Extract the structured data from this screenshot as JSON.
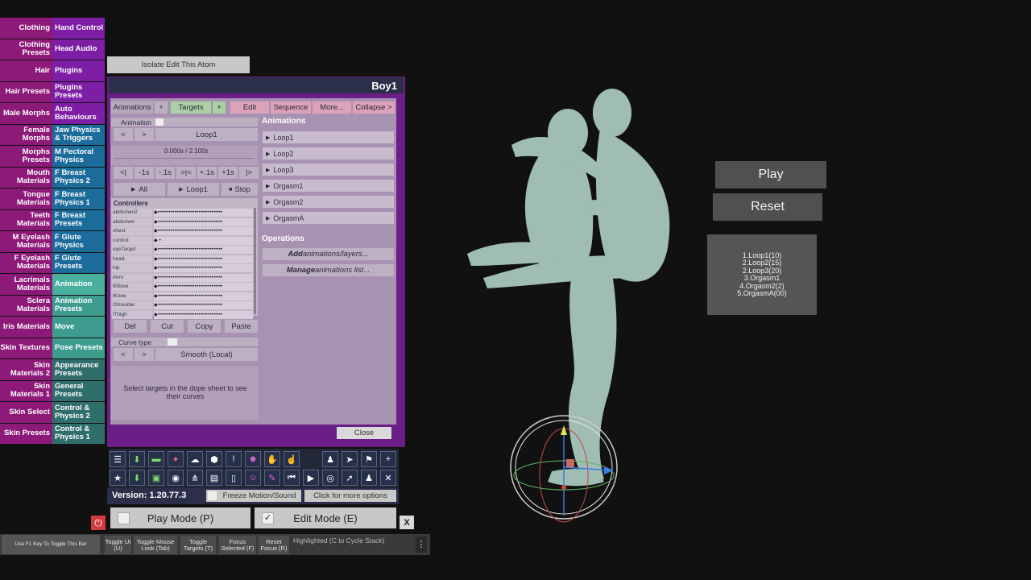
{
  "tabs_left": [
    {
      "label": "Clothing",
      "color": "#8d1a78"
    },
    {
      "label": "Clothing Presets",
      "color": "#8d1a78"
    },
    {
      "label": "Hair",
      "color": "#8d1a78"
    },
    {
      "label": "Hair Presets",
      "color": "#8d1a78"
    },
    {
      "label": "Male Morphs",
      "color": "#8d1a78"
    },
    {
      "label": "Female Morphs",
      "color": "#8d1a78"
    },
    {
      "label": "Morphs Presets",
      "color": "#8d1a78"
    },
    {
      "label": "Mouth Materials",
      "color": "#8d1a78"
    },
    {
      "label": "Tongue Materials",
      "color": "#8d1a78"
    },
    {
      "label": "Teeth Materials",
      "color": "#8d1a78"
    },
    {
      "label": "M Eyelash Materials",
      "color": "#8d1a78"
    },
    {
      "label": "F Eyelash Materials",
      "color": "#8d1a78"
    },
    {
      "label": "Lacrimals Materials",
      "color": "#8d1a78"
    },
    {
      "label": "Sclera Materials",
      "color": "#8d1a78"
    },
    {
      "label": "Iris Materials",
      "color": "#8d1a78"
    },
    {
      "label": "Skin Textures",
      "color": "#8d1a78"
    },
    {
      "label": "Skin Materials 2",
      "color": "#8d1a78"
    },
    {
      "label": "Skin Materials 1",
      "color": "#8d1a78"
    },
    {
      "label": "Skin Select",
      "color": "#8d1a78"
    },
    {
      "label": "Skin Presets",
      "color": "#8d1a78"
    }
  ],
  "tabs_right": [
    {
      "label": "Hand Control",
      "color": "#7d1ea5"
    },
    {
      "label": "Head Audio",
      "color": "#7d1ea5"
    },
    {
      "label": "Plugins",
      "color": "#7d1ea5"
    },
    {
      "label": "Plugins Presets",
      "color": "#7d1ea5"
    },
    {
      "label": "Auto Behaviours",
      "color": "#7d1ea5"
    },
    {
      "label": "Jaw Physics & Triggers",
      "color": "#1c6c9b"
    },
    {
      "label": "M Pectoral Physics",
      "color": "#1c6c9b"
    },
    {
      "label": "F Breast Physics 2",
      "color": "#1c6c9b"
    },
    {
      "label": "F Breast Physics 1",
      "color": "#1c6c9b"
    },
    {
      "label": "F Breast Presets",
      "color": "#1c6c9b"
    },
    {
      "label": "F Glute Physics",
      "color": "#1c6c9b"
    },
    {
      "label": "F Glute Presets",
      "color": "#1c6c9b"
    },
    {
      "label": "Animation",
      "color": "#4ab09e"
    },
    {
      "label": "Animation Presets",
      "color": "#3e9c8e"
    },
    {
      "label": "Move",
      "color": "#3e9c8e"
    },
    {
      "label": "Pose Presets",
      "color": "#3e9c8e"
    },
    {
      "label": "Appearance Presets",
      "color": "#2f6e6a"
    },
    {
      "label": "General Presets",
      "color": "#2f6e6a"
    },
    {
      "label": "Control & Physics 2",
      "color": "#2f6e6a"
    },
    {
      "label": "Control & Physics 1",
      "color": "#2f6e6a"
    }
  ],
  "isolate_button": "Isolate Edit This Atom",
  "panel": {
    "title": "Boy1",
    "tabs": {
      "animations": "Animations",
      "plus1": "+",
      "targets": "Targets",
      "plus2": "+",
      "edit": "Edit",
      "sequence": "Sequence",
      "more": "More...",
      "collapse": "Collapse >"
    },
    "animation_label": "Animation",
    "prev": "<",
    "next": ">",
    "current_animation": "Loop1",
    "time_readout": "0.000s / 2.100s",
    "transport": [
      "<|",
      "-1s",
      "-.1s",
      ">|<",
      "+.1s",
      "+1s",
      "|>"
    ],
    "play_all": "All",
    "play_loop": "Loop1",
    "stop": "Stop",
    "controllers_header": "Controllers",
    "controllers": [
      {
        "name": "abdomen2",
        "dots": "◆•••••••••••••••••••••••••••••••••••"
      },
      {
        "name": "abdomen",
        "dots": "◆•••••••••••••••••••••••••••••••••••"
      },
      {
        "name": "chest",
        "dots": "◆•••••••••••••••••••••••••••••••••••"
      },
      {
        "name": "control",
        "dots": "◆           •"
      },
      {
        "name": "eyeTarget",
        "dots": "◆•••••••••••••••••••••••••••••••••••"
      },
      {
        "name": "head",
        "dots": "◆•••••••••••••••••••••••••••••••••••"
      },
      {
        "name": "hip",
        "dots": "◆•••••••••••••••••••••••••••••••••••"
      },
      {
        "name": "lArm",
        "dots": "◆•••••••••••••••••••••••••••••••••••"
      },
      {
        "name": "lElbow",
        "dots": "◆•••••••••••••••••••••••••••••••••••"
      },
      {
        "name": "lKnee",
        "dots": "◆•••••••••••••••••••••••••••••••••••"
      },
      {
        "name": "lShoulder",
        "dots": "◆•••••••••••••••••••••••••••••••••••"
      },
      {
        "name": "lThigh",
        "dots": "◆•••••••••••••••••••••••••••••••••••"
      }
    ],
    "edit_buttons": [
      "Del",
      "Cut",
      "Copy",
      "Paste"
    ],
    "curve_type_label": "Curve type",
    "curve_value": "Smooth (Local)",
    "hint": "Select targets in the dope sheet to see their curves",
    "animations_header": "Animations",
    "animations": [
      "Loop1",
      "Loop2",
      "Loop3",
      "Orgasm1",
      "Orgasm2",
      "OrgasmA"
    ],
    "operations_header": "Operations",
    "op_add_bold": "Add",
    "op_add_rest": " animations/layers...",
    "op_manage_bold": "Manage",
    "op_manage_rest": " animations list...",
    "close": "Close"
  },
  "toolbar_icons_row1": [
    "menu-icon",
    "save-icon",
    "folder-icon",
    "scene-icon",
    "cloud-icon",
    "package-icon",
    "alert-icon",
    "person-add-icon",
    "hand-icon",
    "hand-point-icon",
    "person-icon",
    "send-icon",
    "flag-icon",
    "plus-icon"
  ],
  "toolbar_icons_row2": [
    "star-icon",
    "save-alt-icon",
    "folder-add-icon",
    "camera-icon",
    "nodes-icon",
    "box-icon",
    "document-icon",
    "person-edit-icon",
    "wrench-icon",
    "skip-back-icon",
    "play-icon",
    "target-icon",
    "cursor-icon",
    "people-icon",
    "tools-icon"
  ],
  "version": "Version: 1.20.77.3",
  "freeze": "Freeze Motion/Sound",
  "more_options": "Click for more options",
  "play_mode": "Play Mode (P)",
  "edit_mode": "Edit Mode (E)",
  "close_x": "X",
  "bottom_bar": {
    "hint": "Use F1 Key To Toggle This Bar",
    "toggle_ui": "Toggle UI (U)",
    "toggle_mouse": "Toggle Mouse Look (Tab)",
    "toggle_targets": "Toggle Targets (T)",
    "focus_selected": "Focus Selected (F)",
    "reset_focus": "Reset Focus (R)",
    "highlighted": "Highlighted (C to Cycle Stack)"
  },
  "scene_buttons": {
    "play": "Play",
    "reset": "Reset"
  },
  "loop_list": [
    "1.Loop1(10)",
    "2.Loop2(15)",
    "2.Loop3(20)",
    "3.Orgasm1",
    "4.Orgasm2(2)",
    "5.OrgasmA(00)"
  ]
}
